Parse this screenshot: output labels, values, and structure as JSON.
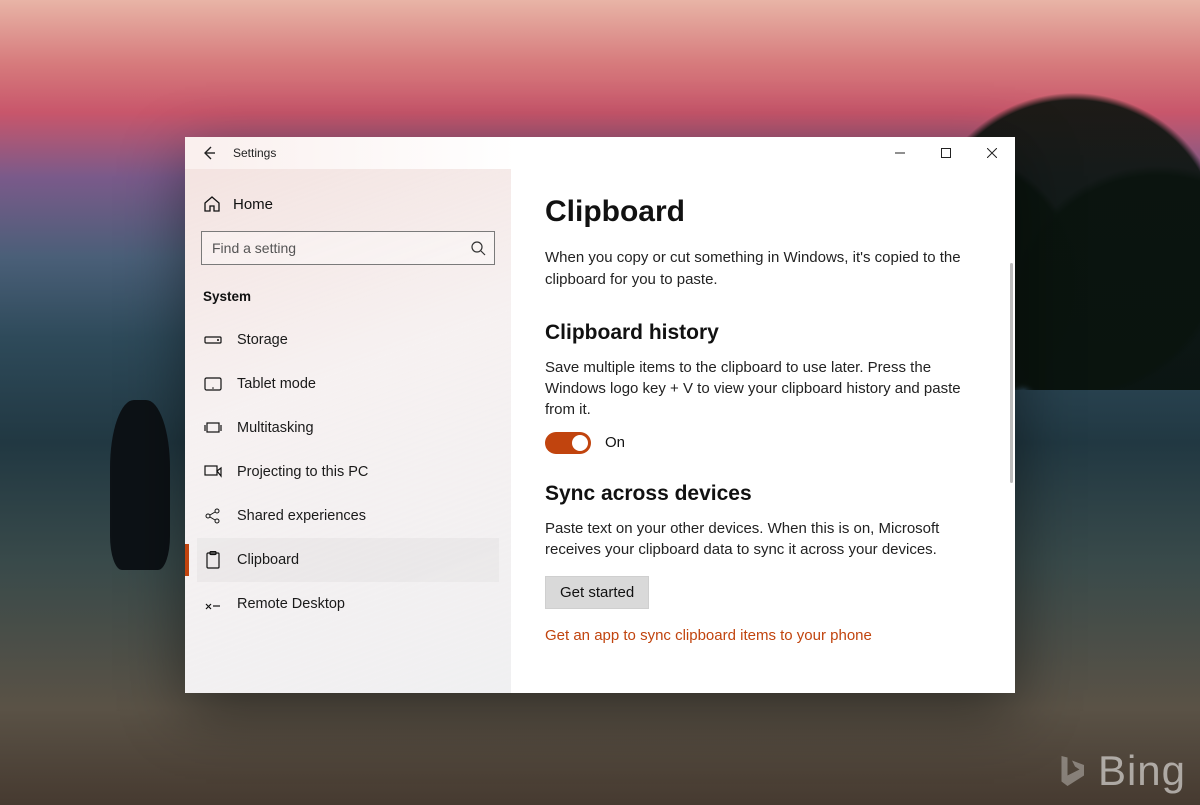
{
  "window": {
    "title": "Settings"
  },
  "sidebar": {
    "home_label": "Home",
    "search_placeholder": "Find a setting",
    "section_title": "System",
    "items": [
      {
        "id": "storage",
        "label": "Storage",
        "icon": "storage-icon",
        "active": false
      },
      {
        "id": "tablet",
        "label": "Tablet mode",
        "icon": "tablet-icon",
        "active": false
      },
      {
        "id": "multitasking",
        "label": "Multitasking",
        "icon": "multitasking-icon",
        "active": false
      },
      {
        "id": "projecting",
        "label": "Projecting to this PC",
        "icon": "projecting-icon",
        "active": false
      },
      {
        "id": "shared",
        "label": "Shared experiences",
        "icon": "shared-icon",
        "active": false
      },
      {
        "id": "clipboard",
        "label": "Clipboard",
        "icon": "clipboard-icon",
        "active": true
      },
      {
        "id": "remote",
        "label": "Remote Desktop",
        "icon": "remote-icon",
        "active": false
      }
    ]
  },
  "main": {
    "title": "Clipboard",
    "intro": "When you copy or cut something in Windows, it's copied to the clipboard for you to paste.",
    "history": {
      "heading": "Clipboard history",
      "desc": "Save multiple items to the clipboard to use later. Press the Windows logo key + V to view your clipboard history and paste from it.",
      "toggle_state": "On",
      "toggle_on": true
    },
    "sync": {
      "heading": "Sync across devices",
      "desc": "Paste text on your other devices. When this is on, Microsoft receives your clipboard data to sync it across your devices.",
      "button": "Get started",
      "link": "Get an app to sync clipboard items to your phone"
    }
  },
  "colors": {
    "accent": "#c1440e"
  },
  "watermark": "Bing"
}
